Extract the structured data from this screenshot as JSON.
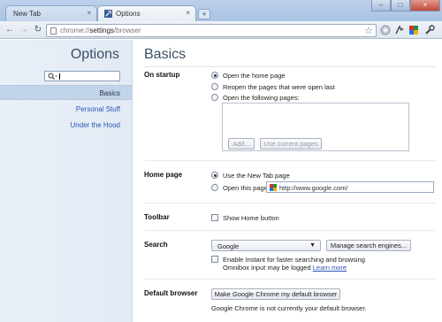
{
  "window": {
    "tabs": [
      {
        "title": "New Tab",
        "close": "×"
      },
      {
        "title": "Options",
        "close": "×"
      }
    ],
    "new_tab_symbol": "+",
    "controls": {
      "minimize": "–",
      "maximize": "□",
      "close": "×"
    }
  },
  "toolbar": {
    "back": "←",
    "forward": "→",
    "reload": "↻",
    "url_scheme": "chrome://",
    "url_host": "settings",
    "url_path": "/browser",
    "star": "☆",
    "icons": [
      "extension-icon",
      "download-icon",
      "apps-icon",
      "wrench-icon"
    ]
  },
  "sidebar": {
    "title": "Options",
    "search_placeholder": "",
    "items": [
      {
        "label": "Basics",
        "active": true
      },
      {
        "label": "Personal Stuff",
        "active": false
      },
      {
        "label": "Under the Hood",
        "active": false
      }
    ]
  },
  "main": {
    "title": "Basics",
    "startup": {
      "label": "On startup",
      "options": [
        {
          "label": "Open the home page",
          "checked": true
        },
        {
          "label": "Reopen the pages that were open last",
          "checked": false
        },
        {
          "label": "Open the following pages:",
          "checked": false
        }
      ],
      "add_button": "Add...",
      "use_current_button": "Use current pages"
    },
    "home_page": {
      "label": "Home page",
      "options": [
        {
          "label": "Use the New Tab page",
          "checked": true
        },
        {
          "label": "Open this page:",
          "checked": false
        }
      ],
      "url": "http://www.google.com/"
    },
    "toolbar_section": {
      "label": "Toolbar",
      "show_home_button": "Show Home button"
    },
    "search": {
      "label": "Search",
      "engine": "Google",
      "manage_button": "Manage search engines...",
      "instant_line1": "Enable Instant for faster searching and browsing",
      "instant_line2": "Omnibox input may be logged",
      "learn_more": "Learn more"
    },
    "default_browser": {
      "label": "Default browser",
      "button": "Make Google Chrome my default browser",
      "status": "Google Chrome is not currently your default browser."
    }
  },
  "colors": {
    "sidebar_bg": "#e6edf6",
    "link": "#2b55b8",
    "title": "#3c4e66",
    "active_item": "#c2d4ea"
  }
}
